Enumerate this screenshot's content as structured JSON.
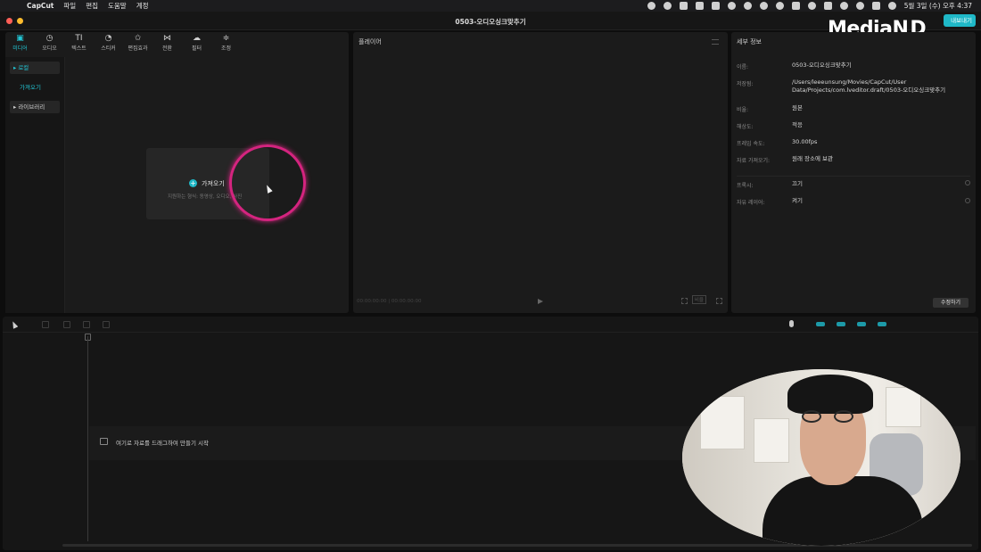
{
  "menubar": {
    "app": "CapCut",
    "items": [
      "파일",
      "편집",
      "도움말",
      "계정"
    ],
    "datetime": "5월 3일 (수) 오후 4:37"
  },
  "window": {
    "title": "0503-오디오싱크맞추기",
    "export_label": "내보내기"
  },
  "overlay": {
    "logo": "MediaN",
    "logo_mark": "D"
  },
  "media": {
    "tools": [
      {
        "label": "미디어",
        "icon": "media-icon",
        "glyph": "▣"
      },
      {
        "label": "오디오",
        "icon": "audio-icon",
        "glyph": "◷"
      },
      {
        "label": "텍스트",
        "icon": "text-icon",
        "glyph": "TI"
      },
      {
        "label": "스티커",
        "icon": "sticker-icon",
        "glyph": "◔"
      },
      {
        "label": "편집효과",
        "icon": "effects-icon",
        "glyph": "✩"
      },
      {
        "label": "전환",
        "icon": "transition-icon",
        "glyph": "⋈"
      },
      {
        "label": "필터",
        "icon": "filter-icon",
        "glyph": "☁"
      },
      {
        "label": "조정",
        "icon": "adjust-icon",
        "glyph": "≑"
      }
    ],
    "sidebar": {
      "local": "▸ 로컬",
      "import": "가져오기",
      "library": "▸ 라이브러리"
    },
    "import_box": {
      "plus": "+",
      "label": "가져오기",
      "sub": "지원하는 형식: 동영상, 오디오, 사진"
    }
  },
  "player": {
    "title": "플레이어",
    "timecode": "00:00:00:00 | 00:00:00:00",
    "ratio": "비율"
  },
  "details": {
    "title": "세부 정보",
    "rows": [
      {
        "label": "이름:",
        "value": "0503-오디오싱크맞추기"
      },
      {
        "label": "저장됨:",
        "value": "/Users/leeeunsung/Movies/CapCut/User Data/Projects/com.lveditor.draft/0503-오디오싱크맞추기"
      },
      {
        "label": "비율:",
        "value": "원본"
      },
      {
        "label": "해상도:",
        "value": "적응"
      },
      {
        "label": "프레임 속도:",
        "value": "30.00fps"
      },
      {
        "label": "자료 가져오기:",
        "value": "원래 장소에 보관"
      },
      {
        "label": "프록시:",
        "value": "끄기"
      },
      {
        "label": "자유 레이어:",
        "value": "켜기"
      }
    ],
    "modify_label": "수정하기"
  },
  "timeline": {
    "hint": "여기로 자료를 드래그하여 만들기 시작"
  },
  "colors": {
    "accent": "#1fb8c7",
    "highlight_ring": "#d4247f",
    "panel": "#1b1b1b",
    "traffic_red": "#ff5f57",
    "traffic_yellow": "#febc2e"
  }
}
